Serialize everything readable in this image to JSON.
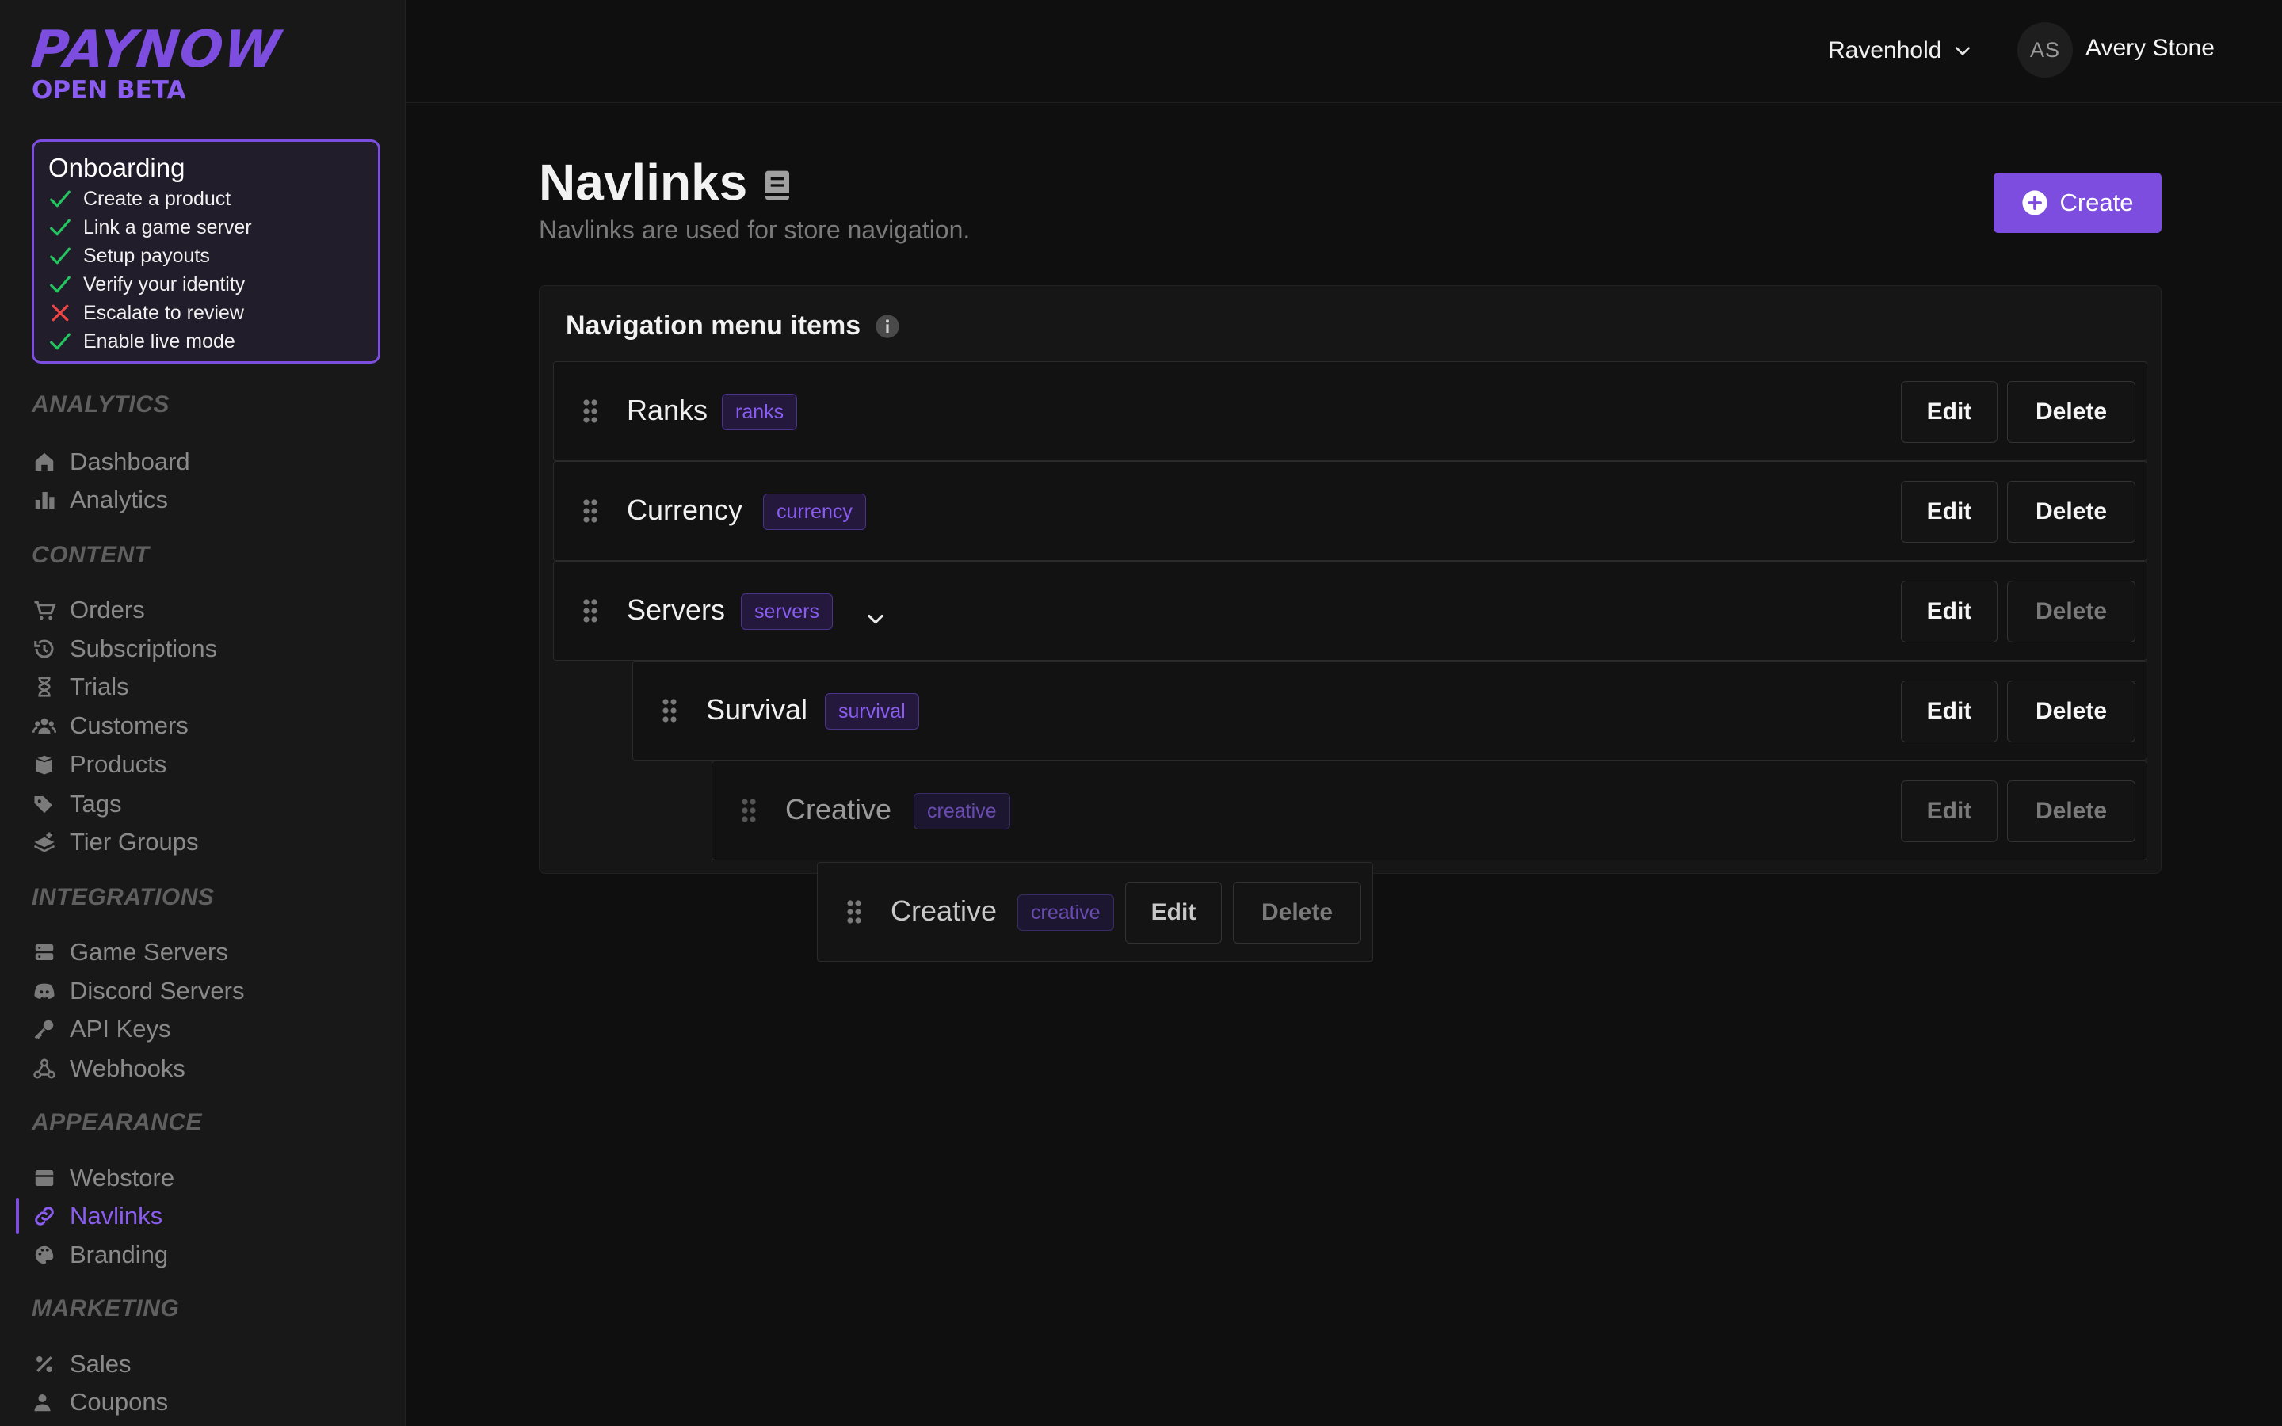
{
  "brand": {
    "name": "PAYNOW",
    "tagline": "OPEN BETA",
    "accent": "#7c4dde"
  },
  "onboarding": {
    "title": "Onboarding",
    "items": [
      {
        "label": "Create a product",
        "done": true
      },
      {
        "label": "Link a game server",
        "done": true
      },
      {
        "label": "Setup payouts",
        "done": true
      },
      {
        "label": "Verify your identity",
        "done": true
      },
      {
        "label": "Escalate to review",
        "done": false
      },
      {
        "label": "Enable live mode",
        "done": true
      }
    ]
  },
  "sidebar": {
    "sections": {
      "analytics": "ANALYTICS",
      "content": "CONTENT",
      "integrations": "INTEGRATIONS",
      "appearance": "APPEARANCE",
      "marketing": "MARKETING"
    },
    "items": {
      "dashboard": "Dashboard",
      "analytics": "Analytics",
      "orders": "Orders",
      "subscriptions": "Subscriptions",
      "trials": "Trials",
      "customers": "Customers",
      "products": "Products",
      "tags": "Tags",
      "tier_groups": "Tier Groups",
      "game_servers": "Game Servers",
      "discord_servers": "Discord Servers",
      "api_keys": "API Keys",
      "webhooks": "Webhooks",
      "webstore": "Webstore",
      "navlinks": "Navlinks",
      "branding": "Branding",
      "sales": "Sales",
      "coupons": "Coupons"
    },
    "active": "navlinks"
  },
  "header": {
    "store_name": "Ravenhold",
    "user_initials": "AS",
    "user_name": "Avery Stone"
  },
  "page": {
    "title": "Navlinks",
    "subtitle": "Navlinks are used for store navigation.",
    "create_label": "Create"
  },
  "card": {
    "title": "Navigation menu items",
    "edit_label": "Edit",
    "delete_label": "Delete",
    "rows": [
      {
        "name": "Ranks",
        "tag": "ranks"
      },
      {
        "name": "Currency",
        "tag": "currency"
      },
      {
        "name": "Servers",
        "tag": "servers"
      },
      {
        "name": "Survival",
        "tag": "survival"
      },
      {
        "name": "Creative",
        "tag": "creative"
      }
    ],
    "dragging": {
      "name": "Creative",
      "tag": "creative"
    }
  }
}
